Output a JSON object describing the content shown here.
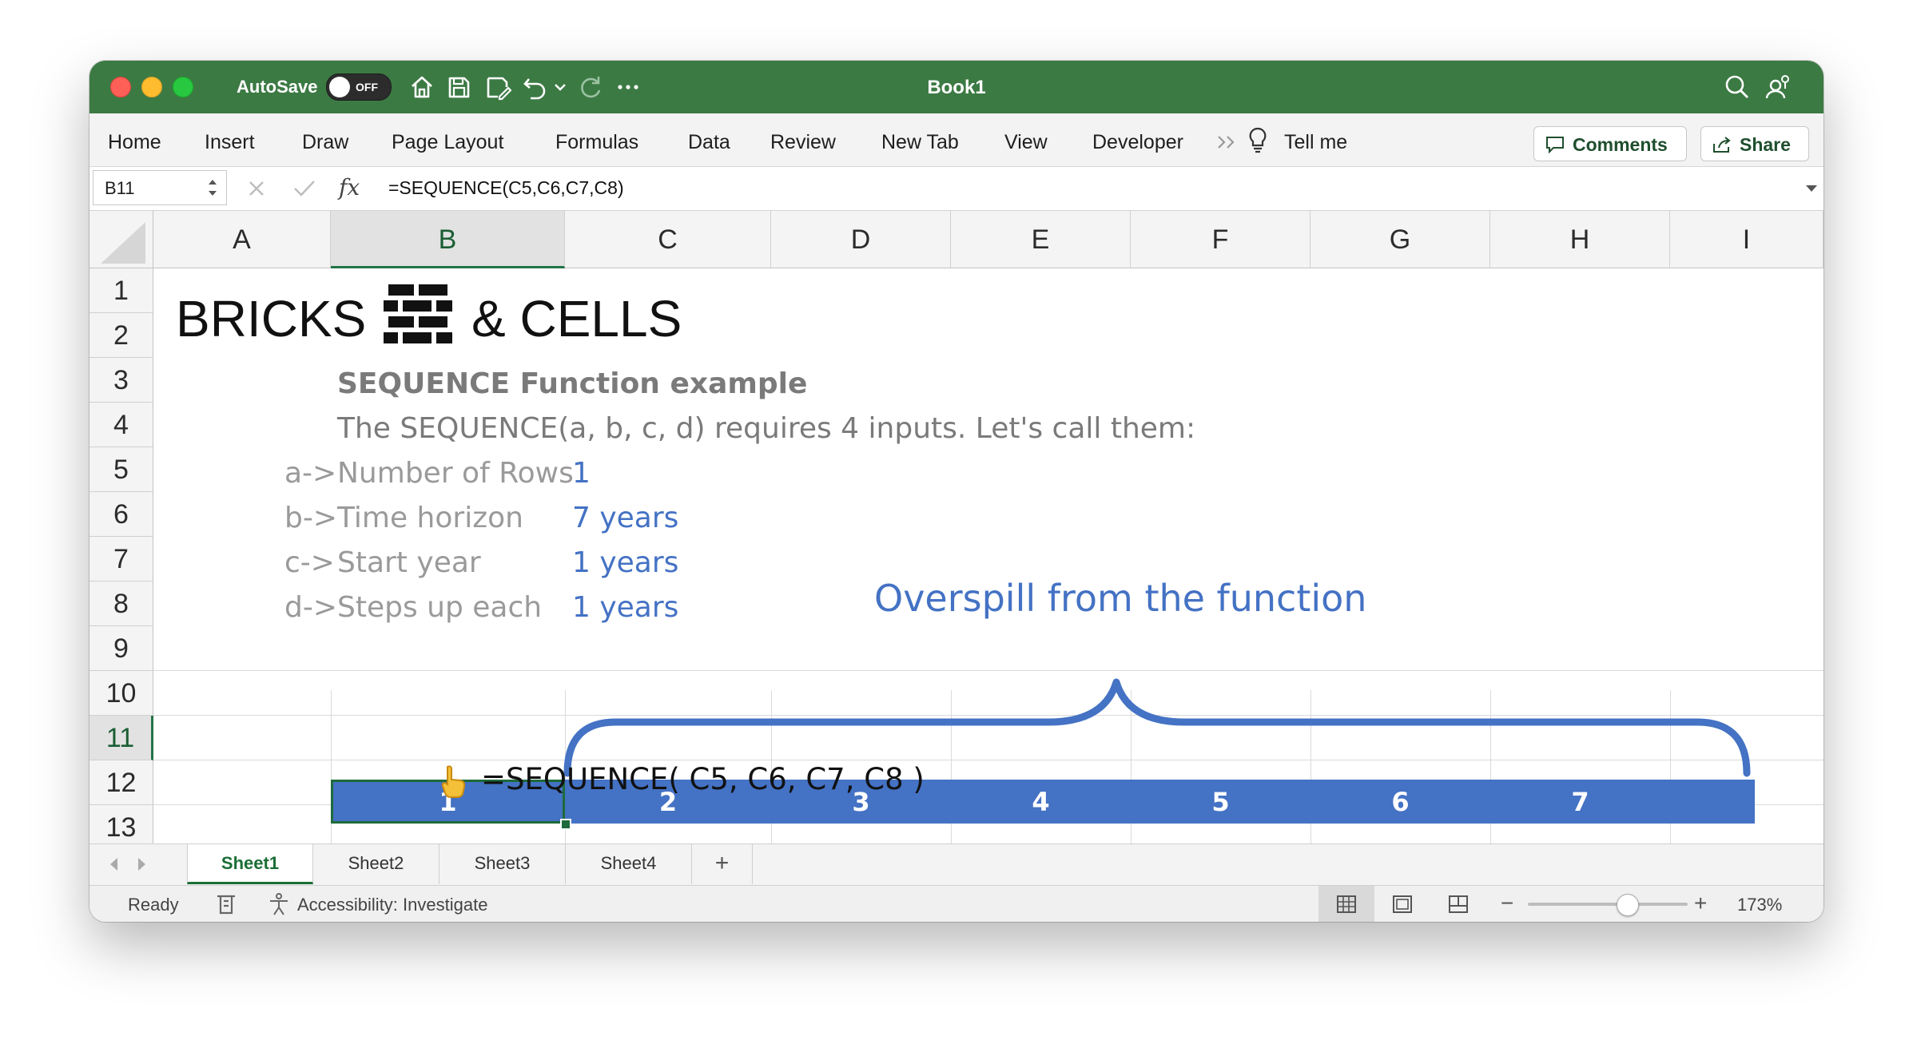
{
  "window": {
    "title": "Book1",
    "autosave_label": "AutoSave",
    "autosave_state": "OFF"
  },
  "ribbon": {
    "tabs": [
      "Home",
      "Insert",
      "Draw",
      "Page Layout",
      "Formulas",
      "Data",
      "Review",
      "New Tab",
      "View",
      "Developer"
    ],
    "tell_me": "Tell me",
    "comments_label": "Comments",
    "share_label": "Share"
  },
  "formula_bar": {
    "name_box": "B11",
    "fx_label": "fx",
    "formula": "=SEQUENCE(C5,C6,C7,C8)"
  },
  "columns": [
    "A",
    "B",
    "C",
    "D",
    "E",
    "F",
    "G",
    "H",
    "I"
  ],
  "rows": [
    "1",
    "2",
    "3",
    "4",
    "5",
    "6",
    "7",
    "8",
    "9",
    "10",
    "11",
    "12",
    "13"
  ],
  "selected_column": "B",
  "selected_row": "11",
  "content": {
    "logo_left": "BRICKS",
    "logo_right": "& CELLS",
    "heading": "SEQUENCE Function example",
    "intro": "The SEQUENCE(a, b, c, d) requires 4 inputs. Let's call them:",
    "params": [
      {
        "key": "a->",
        "label": "Number of Rows",
        "value": "1"
      },
      {
        "key": "b->",
        "label": "Time horizon",
        "value": "7 years"
      },
      {
        "key": "c->",
        "label": "Start year",
        "value": "1 years"
      },
      {
        "key": "d->",
        "label": "Steps up each",
        "value": "1 years"
      }
    ],
    "annotation": "Overspill from the function",
    "sequence_values": [
      "1",
      "2",
      "3",
      "4",
      "5",
      "6",
      "7"
    ],
    "formula_note": "=SEQUENCE( C5, C6, C7, C8 )",
    "accent_color": "#4472c4"
  },
  "sheets": {
    "tabs": [
      "Sheet1",
      "Sheet2",
      "Sheet3",
      "Sheet4"
    ],
    "active": "Sheet1",
    "add_label": "+"
  },
  "status_bar": {
    "ready": "Ready",
    "accessibility": "Accessibility: Investigate",
    "zoom": "173%",
    "zoom_fraction": 0.62
  }
}
